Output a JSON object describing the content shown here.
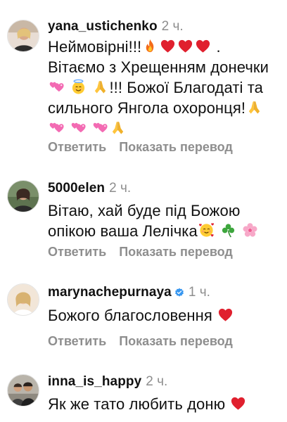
{
  "comments": [
    {
      "username": "yana_ustichenko",
      "time": "2 ч.",
      "lines": [
        "Неймовірні!!!",
        "Вітаємо з Хрещенням донечки",
        "!!! Божої Благодаті та",
        "сильного Янгола охоронця!",
        ""
      ],
      "reply": "Ответить",
      "translate": "Показать перевод"
    },
    {
      "username": "5000elen",
      "time": "2 ч.",
      "lines": [
        "Вітаю, хай буде під Божою",
        "опікою ваша Лелічка"
      ],
      "reply": "Ответить",
      "translate": "Показать перевод"
    },
    {
      "username": "marynachepurnaya",
      "time": "1 ч.",
      "verified": true,
      "lines": [
        "Божого благословення"
      ],
      "reply": "Ответить",
      "translate": "Показать перевод"
    },
    {
      "username": "inna_is_happy",
      "time": "2 ч.",
      "lines": [
        "Як же тато любить доню"
      ]
    }
  ],
  "icons": {
    "fire": "fire-icon",
    "heart": "red-heart-icon",
    "sparkling_heart": "two-hearts-icon",
    "halo": "smiling-face-with-halo-icon",
    "pray": "folded-hands-icon",
    "smiling_hearts": "smiling-face-with-hearts-icon",
    "shamrock": "shamrock-icon",
    "blossom": "cherry-blossom-icon",
    "verified": "verified-badge-icon"
  },
  "colors": {
    "text": "#111111",
    "muted": "#8e8e8e",
    "heart": "#e0202e",
    "verified": "#3897f0"
  }
}
